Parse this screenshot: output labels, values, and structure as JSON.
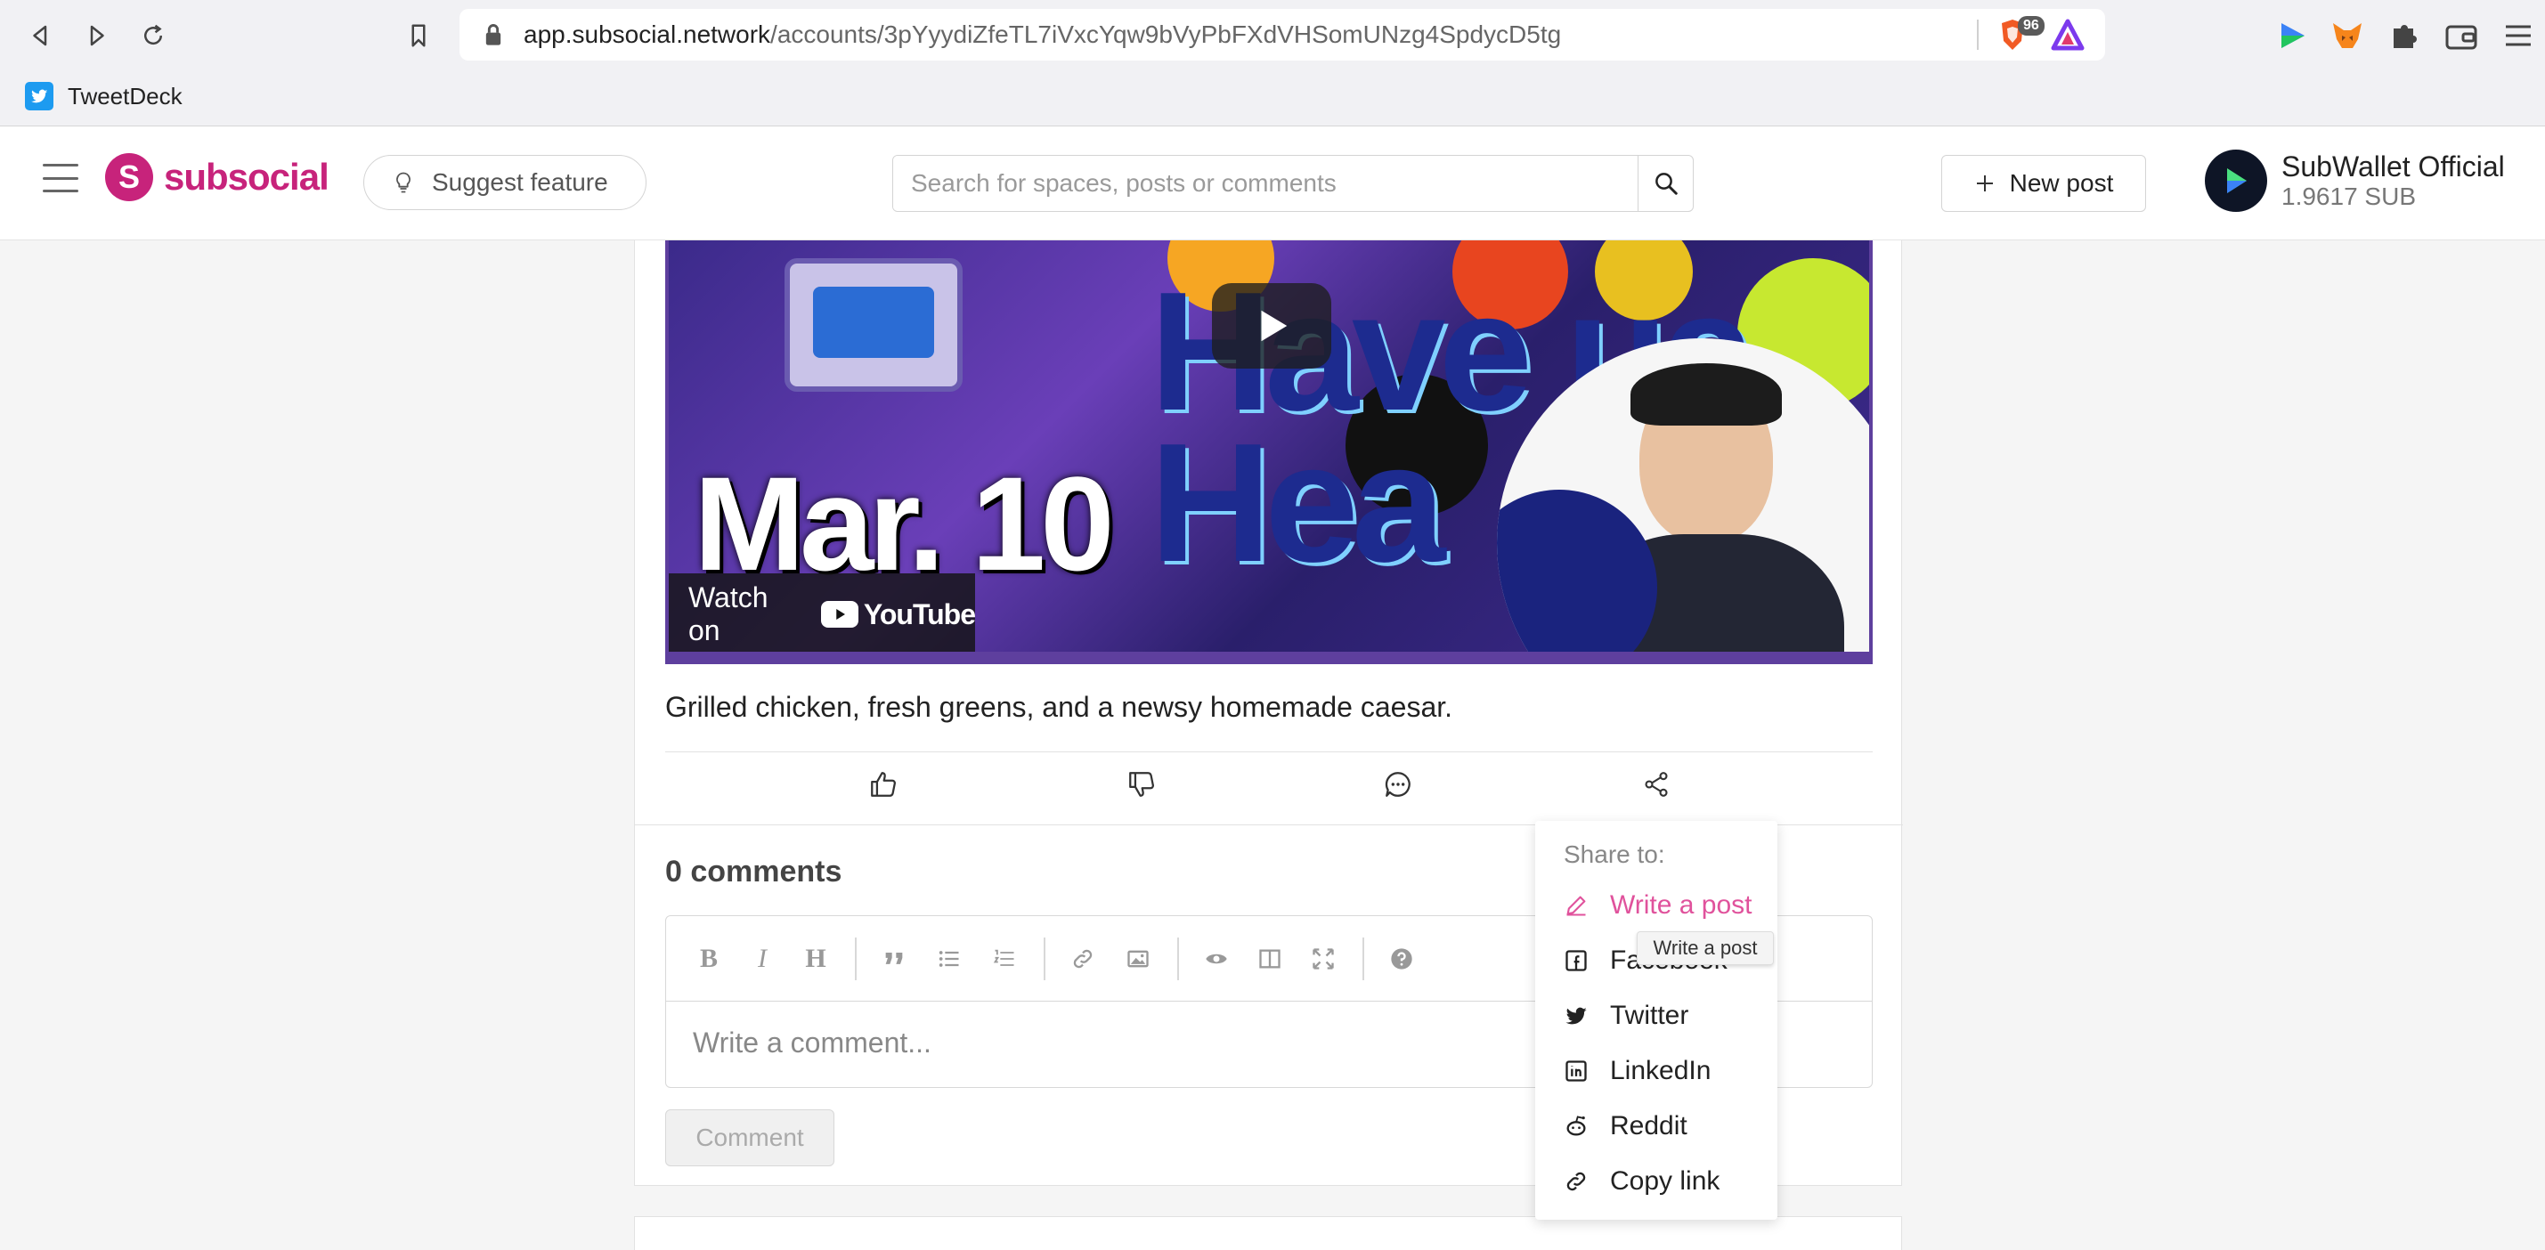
{
  "browser": {
    "url_host": "app.subsocial.network",
    "url_path": "/accounts/3pYyydiZfeTL7iVxcYqw9bVyPbFXdVHSomUNzg4SpdycD5tg",
    "brave_badge_count": "96",
    "bookmarks": [
      {
        "label": "TweetDeck",
        "icon": "twitter-icon"
      }
    ]
  },
  "header": {
    "logo_text": "subsocial",
    "suggest_label": "Suggest feature",
    "search_placeholder": "Search for spaces, posts or comments",
    "new_post_label": "New post",
    "account_name": "SubWallet Official",
    "account_balance": "1.9617 SUB"
  },
  "post": {
    "video": {
      "date_text": "Mar. 10",
      "title_text": "Have ua Hea",
      "watch_on_label": "Watch on",
      "youtube_label": "YouTube"
    },
    "body": "Grilled chicken, fresh greens, and a newsy homemade caesar.",
    "actions": [
      "upvote-icon",
      "downvote-icon",
      "comment-icon",
      "share-icon"
    ]
  },
  "comments": {
    "count_label": "0 comments",
    "input_placeholder": "Write a comment...",
    "submit_label": "Comment",
    "toolbar_icons": [
      "B",
      "I",
      "H",
      "quote",
      "bullet-list",
      "numbered-list",
      "link",
      "image",
      "preview",
      "side-by-side",
      "fullscreen",
      "help"
    ]
  },
  "share_menu": {
    "heading": "Share to:",
    "items": [
      {
        "label": "Write a post",
        "icon": "pencil-icon"
      },
      {
        "label": "Facebook",
        "icon": "facebook-icon"
      },
      {
        "label": "Twitter",
        "icon": "twitter-icon"
      },
      {
        "label": "LinkedIn",
        "icon": "linkedin-icon"
      },
      {
        "label": "Reddit",
        "icon": "reddit-icon"
      },
      {
        "label": "Copy link",
        "icon": "link-icon"
      }
    ],
    "tooltip": "Write a post"
  },
  "colors": {
    "brand": "#c7237b",
    "active_menu": "#e0529c"
  }
}
